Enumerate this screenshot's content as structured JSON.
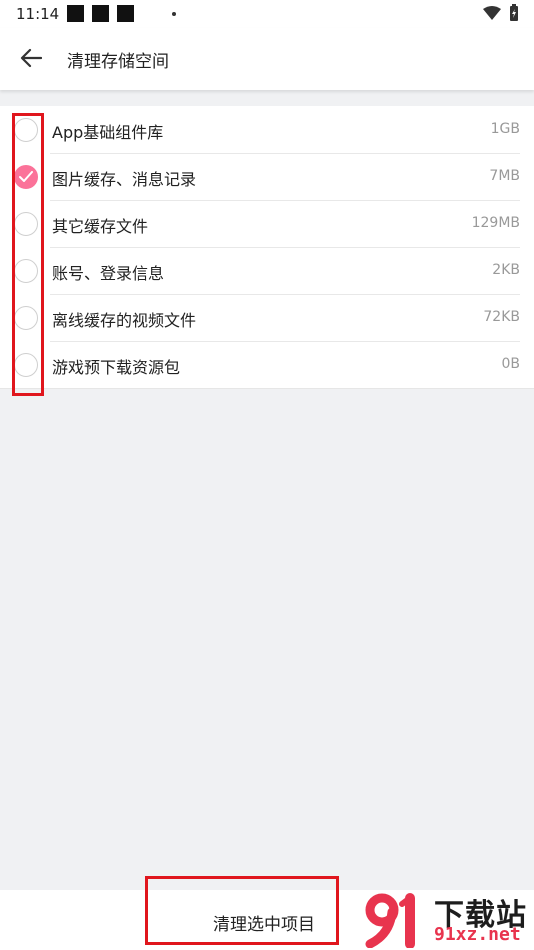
{
  "status_bar": {
    "time": "11:14",
    "notification_count_boxes": 3
  },
  "app_bar": {
    "back_icon": "arrow-left-icon",
    "title": "清理存储空间"
  },
  "storage_items": [
    {
      "label": "App基础组件库",
      "size": "1GB",
      "checked": false
    },
    {
      "label": "图片缓存、消息记录",
      "size": "7MB",
      "checked": true
    },
    {
      "label": "其它缓存文件",
      "size": "129MB",
      "checked": false
    },
    {
      "label": "账号、登录信息",
      "size": "2KB",
      "checked": false
    },
    {
      "label": "离线缓存的视频文件",
      "size": "72KB",
      "checked": false
    },
    {
      "label": "游戏预下载资源包",
      "size": "0B",
      "checked": false
    }
  ],
  "bottom_bar": {
    "clean_button_label": "清理选中项目"
  },
  "watermark": {
    "title": "下载站",
    "domain": "91xz.net"
  },
  "colors": {
    "accent": "#fb7299",
    "annotation": "#e0161d",
    "background": "#f0f1f3"
  }
}
